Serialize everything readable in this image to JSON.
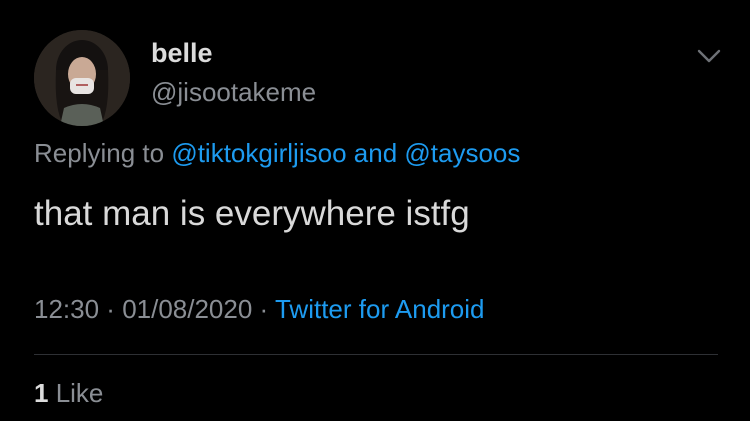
{
  "tweet": {
    "display_name": "belle",
    "handle": "@jisootakeme",
    "replying_prefix": "Replying to ",
    "reply_mention_1": "@tiktokgirljisoo",
    "reply_joiner": " and ",
    "reply_mention_2": "@taysoos",
    "text": "that man is everywhere istfg",
    "time": "12:30",
    "separator": " · ",
    "date": "01/08/2020",
    "source": "Twitter for Android",
    "like_count": "1",
    "like_label": " Like"
  },
  "icons": {
    "more": "chevron-down-icon",
    "avatar": "avatar"
  },
  "colors": {
    "background": "#000000",
    "text": "#d9d9d9",
    "muted": "#8a8e94",
    "link": "#1d9bf0",
    "divider": "#2e3034"
  }
}
